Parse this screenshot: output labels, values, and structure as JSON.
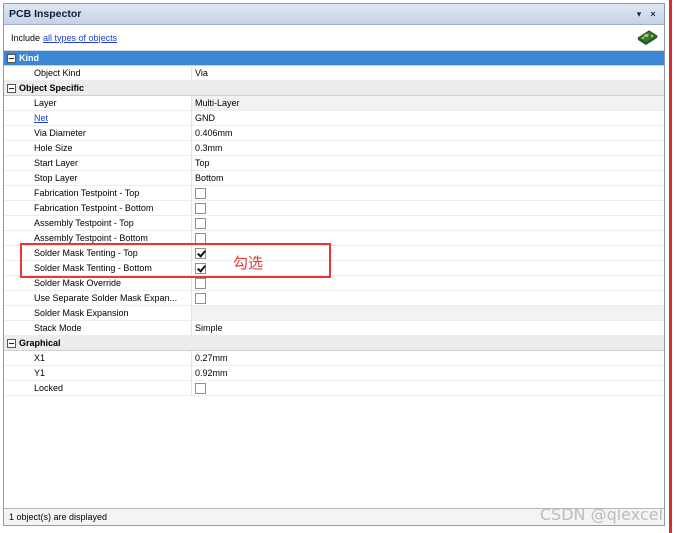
{
  "window": {
    "title": "PCB Inspector",
    "menu_icon": "▾",
    "close_icon": "×"
  },
  "include": {
    "prefix": "Include",
    "link": "all types of objects"
  },
  "categories": {
    "kind": "Kind",
    "object_specific": "Object Specific",
    "graphical": "Graphical"
  },
  "rows": {
    "object_kind": {
      "name": "Object Kind",
      "value": "Via"
    },
    "layer": {
      "name": "Layer",
      "value": "Multi-Layer"
    },
    "net": {
      "name": "Net",
      "value": "GND"
    },
    "via_diameter": {
      "name": "Via Diameter",
      "value": "0.406mm"
    },
    "hole_size": {
      "name": "Hole Size",
      "value": "0.3mm"
    },
    "start_layer": {
      "name": "Start Layer",
      "value": "Top"
    },
    "stop_layer": {
      "name": "Stop Layer",
      "value": "Bottom"
    },
    "fab_top": {
      "name": "Fabrication Testpoint - Top",
      "checked": false
    },
    "fab_bottom": {
      "name": "Fabrication Testpoint - Bottom",
      "checked": false
    },
    "asm_top": {
      "name": "Assembly Testpoint - Top",
      "checked": false
    },
    "asm_bottom": {
      "name": "Assembly Testpoint - Bottom",
      "checked": false
    },
    "tent_top": {
      "name": "Solder Mask Tenting - Top",
      "checked": true
    },
    "tent_bottom": {
      "name": "Solder Mask Tenting - Bottom",
      "checked": true
    },
    "mask_override": {
      "name": "Solder Mask Override",
      "checked": false
    },
    "separate_mask": {
      "name": "Use Separate Solder Mask Expan...",
      "checked": false
    },
    "mask_expansion": {
      "name": "Solder Mask Expansion",
      "value": ""
    },
    "stack_mode": {
      "name": "Stack Mode",
      "value": "Simple"
    },
    "x1": {
      "name": "X1",
      "value": "0.27mm"
    },
    "y1": {
      "name": "Y1",
      "value": "0.92mm"
    },
    "locked": {
      "name": "Locked",
      "checked": false
    }
  },
  "status": "1 object(s) are displayed",
  "annotation": "勾选",
  "watermark": "CSDN @qlexcel",
  "colors": {
    "selected_category": "#3b87d6",
    "annotation_red": "#e53935",
    "link_blue": "#1f3fcc"
  }
}
